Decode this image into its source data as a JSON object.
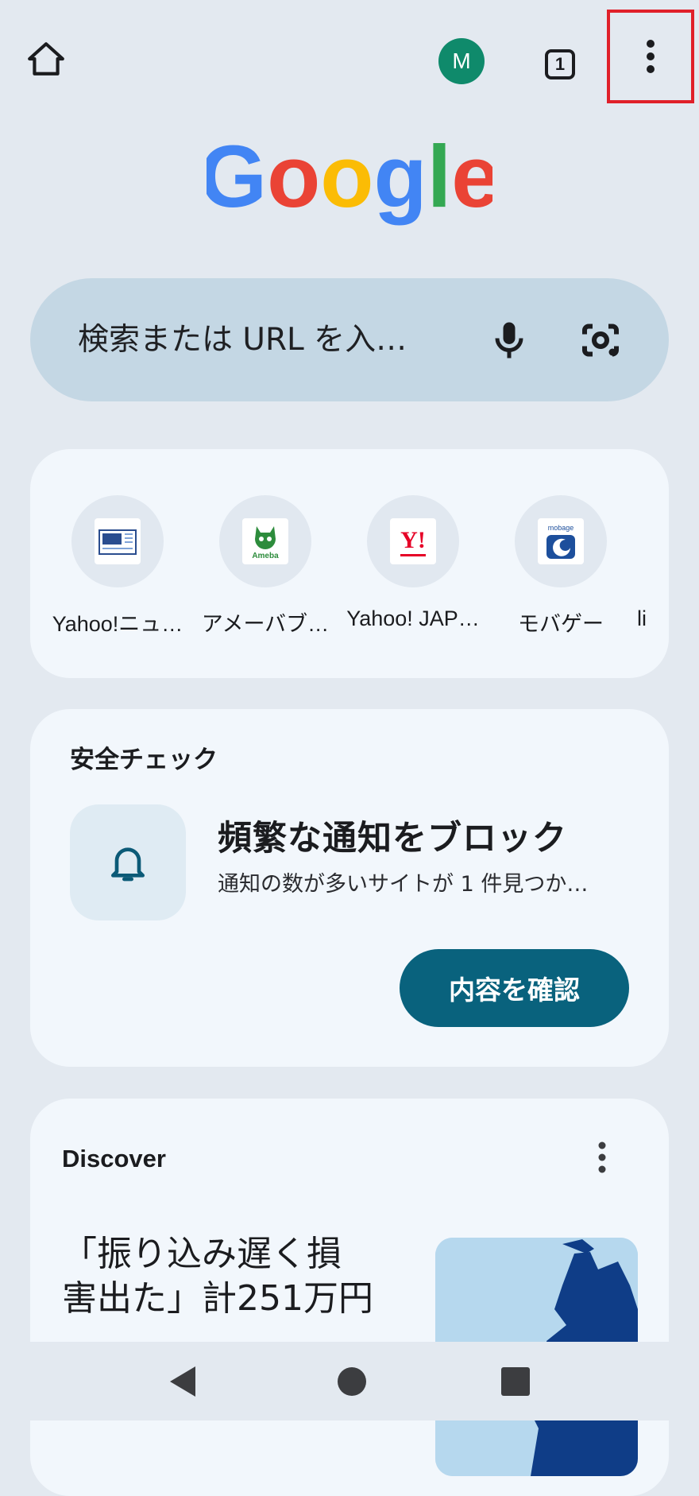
{
  "toolbar": {
    "avatar_letter": "M",
    "tab_count": "1"
  },
  "logo": {
    "letters": [
      "G",
      "o",
      "o",
      "g",
      "l",
      "e"
    ],
    "colors": [
      "#4285F4",
      "#EA4335",
      "#FBBC05",
      "#4285F4",
      "#34A853",
      "#EA4335"
    ]
  },
  "search": {
    "placeholder": "検索または URL を入…"
  },
  "shortcuts": [
    {
      "label": "Yahoo!ニュ…",
      "icon": "news-icon"
    },
    {
      "label": "アメーバブ…",
      "icon": "ameba-icon"
    },
    {
      "label": "Yahoo! JAP…",
      "icon": "yahoo-icon"
    },
    {
      "label": "モバゲー",
      "icon": "mobage-icon"
    },
    {
      "label": "li",
      "icon": ""
    }
  ],
  "safety_check": {
    "title": "安全チェック",
    "heading": "頻繁な通知をブロック",
    "subtext": "通知の数が多いサイトが 1 件見つか…",
    "button": "内容を確認"
  },
  "discover": {
    "title": "Discover",
    "article_line1": "「振り込み遅く損",
    "article_line2": "害出た」計251万円",
    "article_line3": "   "
  },
  "colors": {
    "accent": "#09627d",
    "highlight_border": "#e0202a",
    "avatar_bg": "#0f8a6b"
  }
}
